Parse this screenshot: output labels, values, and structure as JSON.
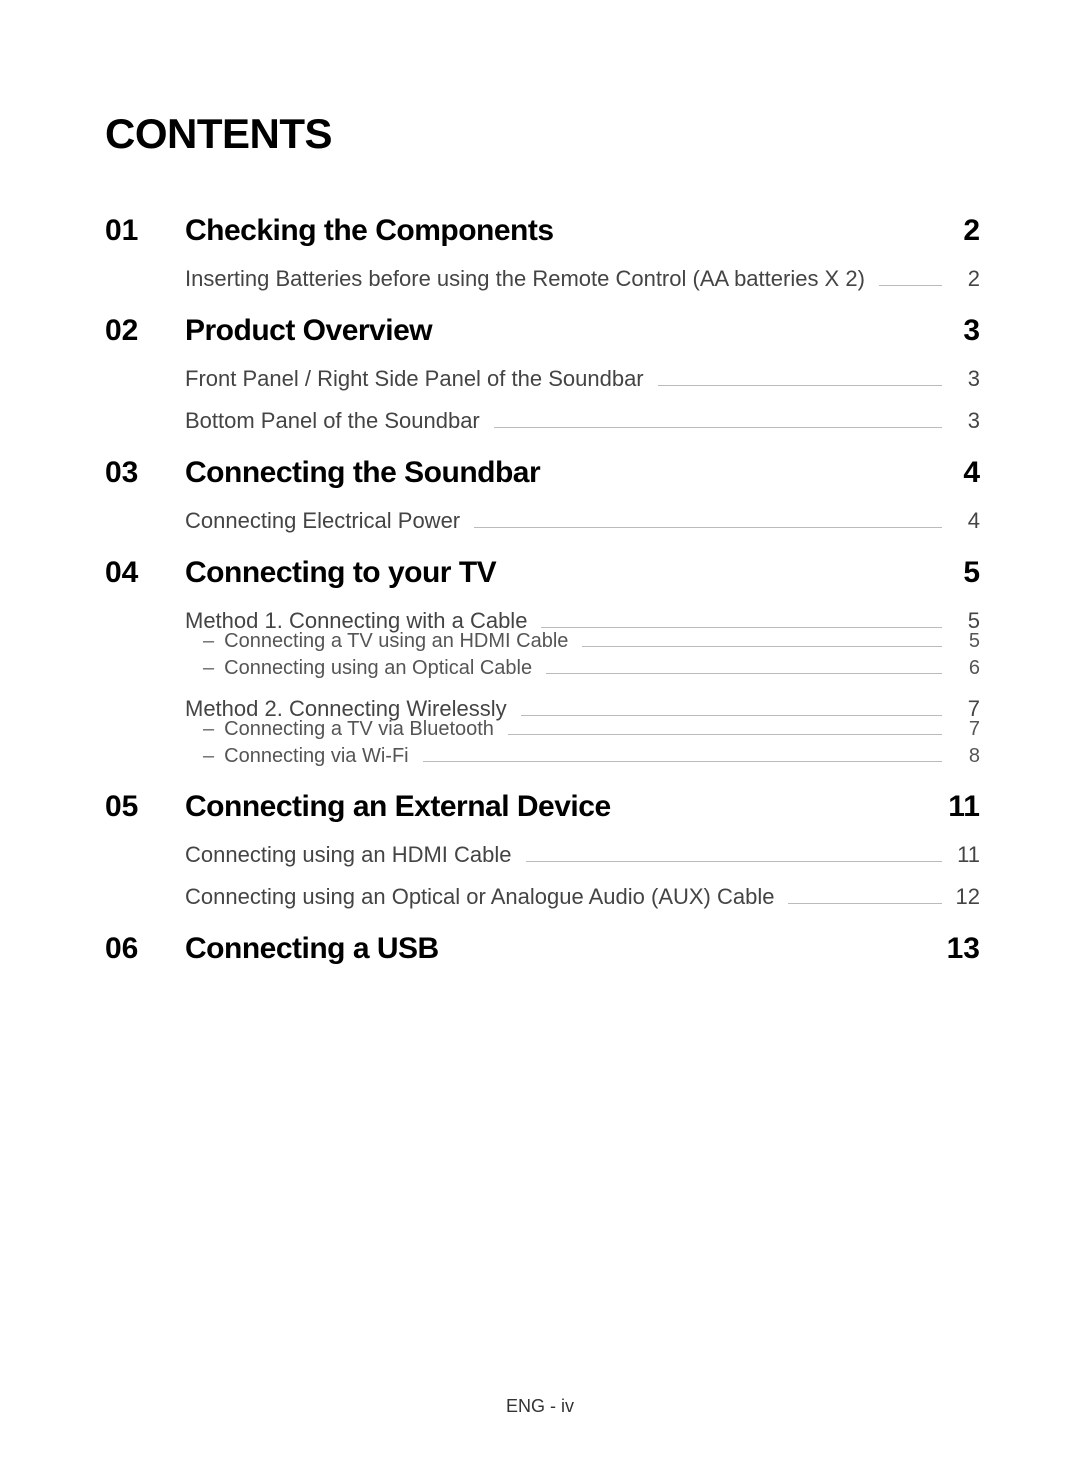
{
  "title": "CONTENTS",
  "footer": "ENG - iv",
  "sections": [
    {
      "number": "01",
      "title": "Checking the Components",
      "page": "2",
      "entries": [
        {
          "title": "Inserting Batteries before using the Remote Control (AA batteries X 2)",
          "page": "2"
        }
      ]
    },
    {
      "number": "02",
      "title": "Product Overview",
      "page": "3",
      "entries": [
        {
          "title": "Front Panel / Right Side Panel of the Soundbar",
          "page": "3"
        },
        {
          "title": "Bottom Panel of the Soundbar",
          "page": "3"
        }
      ]
    },
    {
      "number": "03",
      "title": "Connecting the Soundbar",
      "page": "4",
      "entries": [
        {
          "title": "Connecting Electrical Power",
          "page": "4"
        }
      ]
    },
    {
      "number": "04",
      "title": "Connecting to your TV",
      "page": "5",
      "entries": [
        {
          "title": "Method 1. Connecting with a Cable",
          "page": "5",
          "subs": [
            {
              "title": "Connecting a TV using an HDMI Cable",
              "page": "5"
            },
            {
              "title": "Connecting using an Optical Cable",
              "page": "6"
            }
          ]
        },
        {
          "title": "Method 2. Connecting Wirelessly",
          "page": "7",
          "subs": [
            {
              "title": "Connecting a TV via Bluetooth",
              "page": "7"
            },
            {
              "title": "Connecting via Wi-Fi",
              "page": "8"
            }
          ]
        }
      ]
    },
    {
      "number": "05",
      "title": "Connecting an External Device",
      "page": "11",
      "entries": [
        {
          "title": "Connecting using an HDMI Cable",
          "page": "11"
        },
        {
          "title": "Connecting using an Optical or Analogue Audio (AUX) Cable",
          "page": "12"
        }
      ]
    },
    {
      "number": "06",
      "title": "Connecting a USB",
      "page": "13",
      "entries": []
    }
  ]
}
